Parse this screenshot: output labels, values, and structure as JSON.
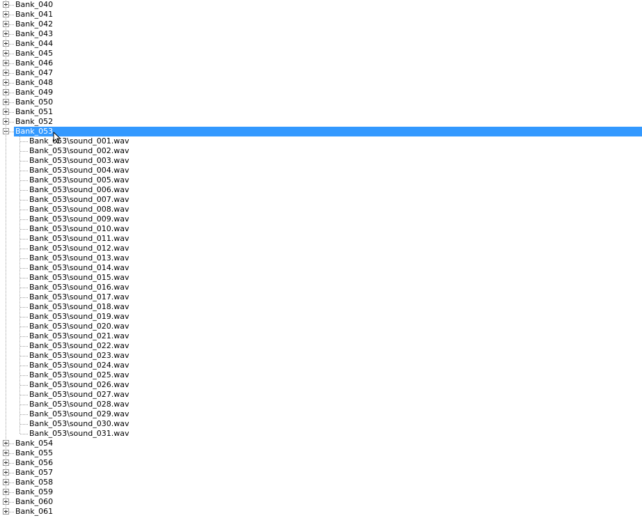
{
  "colors": {
    "selection_bg": "#3399ff",
    "selection_text": "#ffffff",
    "tree_line": "#a0a0a0",
    "expander_border": "#919191"
  },
  "icons": {
    "collapsed_expander": "plus-box-icon",
    "expanded_expander": "minus-box-icon",
    "mouse_cursor": "arrow-cursor-icon"
  },
  "tree": {
    "banks_before": [
      {
        "label": "Bank_040"
      },
      {
        "label": "Bank_041"
      },
      {
        "label": "Bank_042"
      },
      {
        "label": "Bank_043"
      },
      {
        "label": "Bank_044"
      },
      {
        "label": "Bank_045"
      },
      {
        "label": "Bank_046"
      },
      {
        "label": "Bank_047"
      },
      {
        "label": "Bank_048"
      },
      {
        "label": "Bank_049"
      },
      {
        "label": "Bank_050"
      },
      {
        "label": "Bank_051"
      },
      {
        "label": "Bank_052"
      }
    ],
    "expanded_bank": {
      "label": "Bank_053",
      "selected": true,
      "children": [
        {
          "label": "Bank_053\\sound_001.wav"
        },
        {
          "label": "Bank_053\\sound_002.wav"
        },
        {
          "label": "Bank_053\\sound_003.wav"
        },
        {
          "label": "Bank_053\\sound_004.wav"
        },
        {
          "label": "Bank_053\\sound_005.wav"
        },
        {
          "label": "Bank_053\\sound_006.wav"
        },
        {
          "label": "Bank_053\\sound_007.wav"
        },
        {
          "label": "Bank_053\\sound_008.wav"
        },
        {
          "label": "Bank_053\\sound_009.wav"
        },
        {
          "label": "Bank_053\\sound_010.wav"
        },
        {
          "label": "Bank_053\\sound_011.wav"
        },
        {
          "label": "Bank_053\\sound_012.wav"
        },
        {
          "label": "Bank_053\\sound_013.wav"
        },
        {
          "label": "Bank_053\\sound_014.wav"
        },
        {
          "label": "Bank_053\\sound_015.wav"
        },
        {
          "label": "Bank_053\\sound_016.wav"
        },
        {
          "label": "Bank_053\\sound_017.wav"
        },
        {
          "label": "Bank_053\\sound_018.wav"
        },
        {
          "label": "Bank_053\\sound_019.wav"
        },
        {
          "label": "Bank_053\\sound_020.wav"
        },
        {
          "label": "Bank_053\\sound_021.wav"
        },
        {
          "label": "Bank_053\\sound_022.wav"
        },
        {
          "label": "Bank_053\\sound_023.wav"
        },
        {
          "label": "Bank_053\\sound_024.wav"
        },
        {
          "label": "Bank_053\\sound_025.wav"
        },
        {
          "label": "Bank_053\\sound_026.wav"
        },
        {
          "label": "Bank_053\\sound_027.wav"
        },
        {
          "label": "Bank_053\\sound_028.wav"
        },
        {
          "label": "Bank_053\\sound_029.wav"
        },
        {
          "label": "Bank_053\\sound_030.wav"
        },
        {
          "label": "Bank_053\\sound_031.wav"
        }
      ]
    },
    "banks_after": [
      {
        "label": "Bank_054"
      },
      {
        "label": "Bank_055"
      },
      {
        "label": "Bank_056"
      },
      {
        "label": "Bank_057"
      },
      {
        "label": "Bank_058"
      },
      {
        "label": "Bank_059"
      },
      {
        "label": "Bank_060"
      },
      {
        "label": "Bank_061"
      }
    ]
  }
}
